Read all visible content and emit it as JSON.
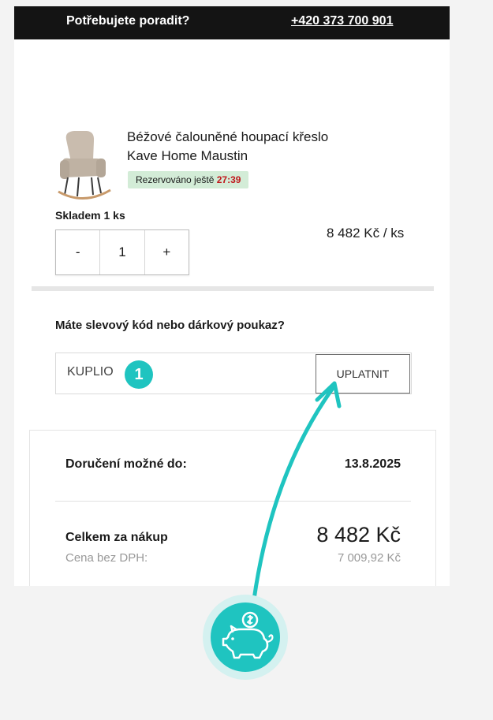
{
  "header": {
    "help_text": "Potřebujete poradit?",
    "phone": "+420 373 700 901"
  },
  "product": {
    "name_line1": "Béžové čalouněné houpací křeslo",
    "name_line2": "Kave Home Maustin",
    "reserved_label": "Rezervováno ještě",
    "reserved_timer": "27:39",
    "stock": "Skladem 1 ks",
    "qty_minus": "-",
    "qty_value": "1",
    "qty_plus": "+",
    "unit_price": "8 482 Kč  / ks"
  },
  "discount": {
    "title": "Máte slevový kód nebo dárkový poukaz?",
    "code": "KUPLIO",
    "apply_label": "UPLATNIT"
  },
  "summary": {
    "delivery_label": "Doručení možné do:",
    "delivery_date": "13.8.2025",
    "total_label": "Celkem za nákup",
    "total_value": "8 482 Kč",
    "net_label": "Cena bez DPH:",
    "net_value": "7 009,92 Kč"
  },
  "annotation": {
    "step_number": "1",
    "accent_color": "#1fc4c0",
    "icon": "piggy-bank-coin-icon"
  }
}
